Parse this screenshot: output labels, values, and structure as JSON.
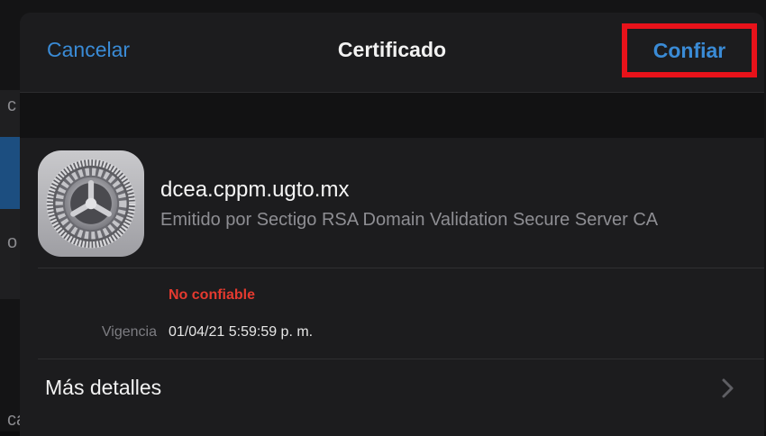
{
  "background": {
    "partial_glyphs": [
      "c",
      "o",
      "ca"
    ]
  },
  "navbar": {
    "cancel_label": "Cancelar",
    "title": "Certificado",
    "trust_label": "Confiar",
    "highlight_color": "#e8121a",
    "link_color": "#3a8bd6"
  },
  "certificate": {
    "icon": "gear-settings-icon",
    "name": "dcea.cppm.ugto.mx",
    "issuer": "Emitido por Sectigo RSA Domain Validation Secure Server CA",
    "status": "No confiable",
    "status_color": "#e53a2f",
    "validity_label": "Vigencia",
    "validity_value": "01/04/21 5:59:59 p. m."
  },
  "details": {
    "label": "Más detalles",
    "icon": "chevron-right-icon"
  }
}
